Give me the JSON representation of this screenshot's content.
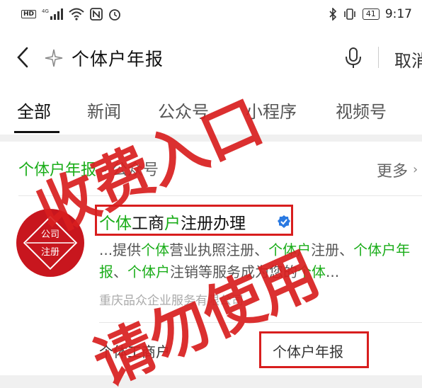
{
  "status_bar": {
    "hd_label": "HD",
    "network_label": "4G",
    "battery_level": "41",
    "time": "9:17"
  },
  "search": {
    "query": "个体户年报",
    "cancel_label": "取消"
  },
  "tabs": [
    {
      "label": "全部",
      "active": true
    },
    {
      "label": "新闻",
      "active": false
    },
    {
      "label": "公众号",
      "active": false
    },
    {
      "label": "小程序",
      "active": false
    },
    {
      "label": "视频号",
      "active": false
    }
  ],
  "section": {
    "keyword": "个体户年报",
    "separator": " - ",
    "category": "公众号",
    "more_label": "更多"
  },
  "account": {
    "avatar_text_top": "公司",
    "avatar_text_bottom": "注册",
    "title_parts": [
      {
        "text": "个体",
        "hl": true
      },
      {
        "text": "工商",
        "hl": false
      },
      {
        "text": "户",
        "hl": true
      },
      {
        "text": "注册办理",
        "hl": false
      }
    ],
    "description_parts": [
      {
        "text": "...提供",
        "hl": false
      },
      {
        "text": "个体",
        "hl": true
      },
      {
        "text": "营业执照注册、",
        "hl": false
      },
      {
        "text": "个体户",
        "hl": true
      },
      {
        "text": "注册、",
        "hl": false
      },
      {
        "text": "个体户年报",
        "hl": true
      },
      {
        "text": "、",
        "hl": false
      },
      {
        "text": "个体户",
        "hl": true
      },
      {
        "text": "注销等服务成为您的",
        "hl": false
      },
      {
        "text": "个体",
        "hl": true
      },
      {
        "text": "...",
        "hl": false
      }
    ],
    "company": "重庆品众企业服务有限公司",
    "menu_items": [
      "个体工商户",
      "个体户年报"
    ]
  },
  "watermark": {
    "line1": "收费入口",
    "line2": "请勿使用"
  },
  "colors": {
    "highlight_green": "#1aad19",
    "watermark_red": "#d81e1e",
    "avatar_red": "#c8161e"
  }
}
